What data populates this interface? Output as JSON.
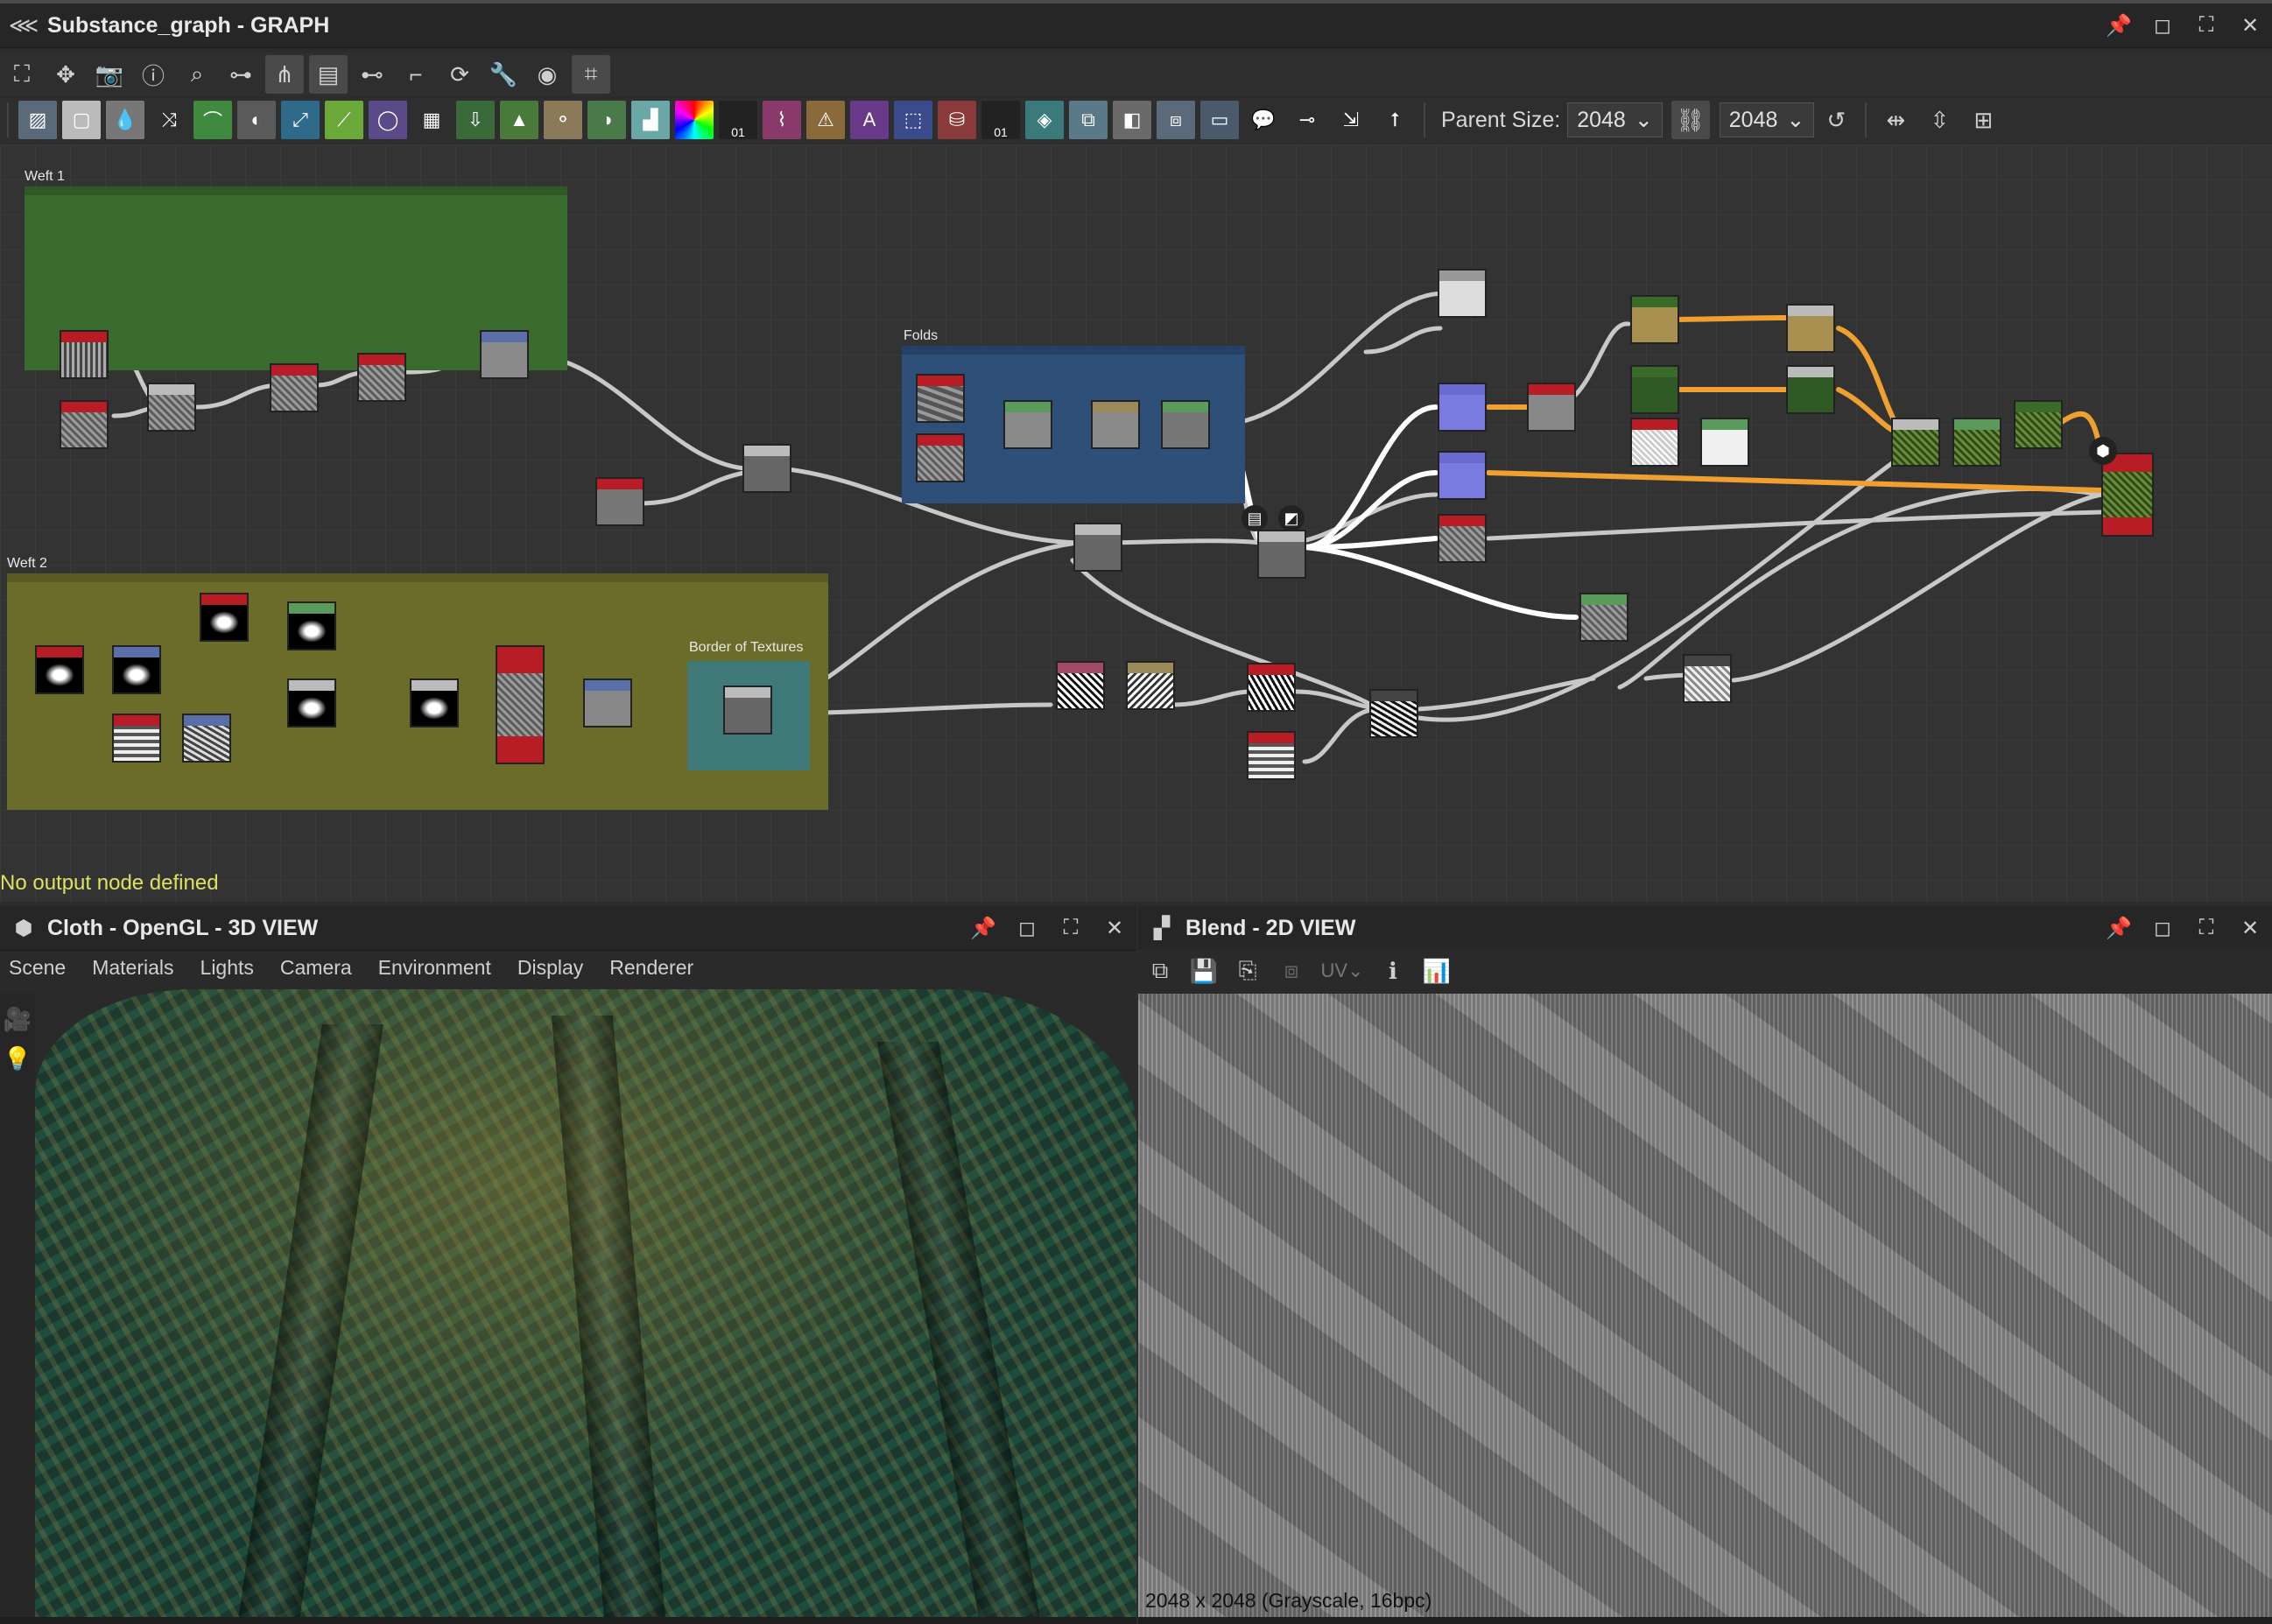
{
  "graph_window": {
    "title": "Substance_graph - GRAPH",
    "parent_size_label": "Parent Size:",
    "parent_size_value": "2048",
    "size_value": "2048",
    "status": "No output node defined"
  },
  "frames": {
    "weft1": "Weft 1",
    "weft2": "Weft 2",
    "folds": "Folds",
    "border": "Border of Textures"
  },
  "library_glyphs": {
    "counter1": "01",
    "counter2": "01",
    "text_tool": "A"
  },
  "view3d": {
    "title": "Cloth - OpenGL - 3D VIEW",
    "menu": [
      "Scene",
      "Materials",
      "Lights",
      "Camera",
      "Environment",
      "Display",
      "Renderer"
    ]
  },
  "view2d": {
    "title": "Blend - 2D VIEW",
    "uv_label": "UV",
    "resolution": "2048 x 2048 (Grayscale, 16bpc)"
  },
  "colors": {
    "weft1_frame": "#3a6b2e",
    "weft2_frame": "#6b6b2a",
    "folds_frame": "#2d4f78",
    "border_frame": "#3f7a78",
    "status_yellow": "#e0e060",
    "connection_orange": "#f0a030"
  }
}
